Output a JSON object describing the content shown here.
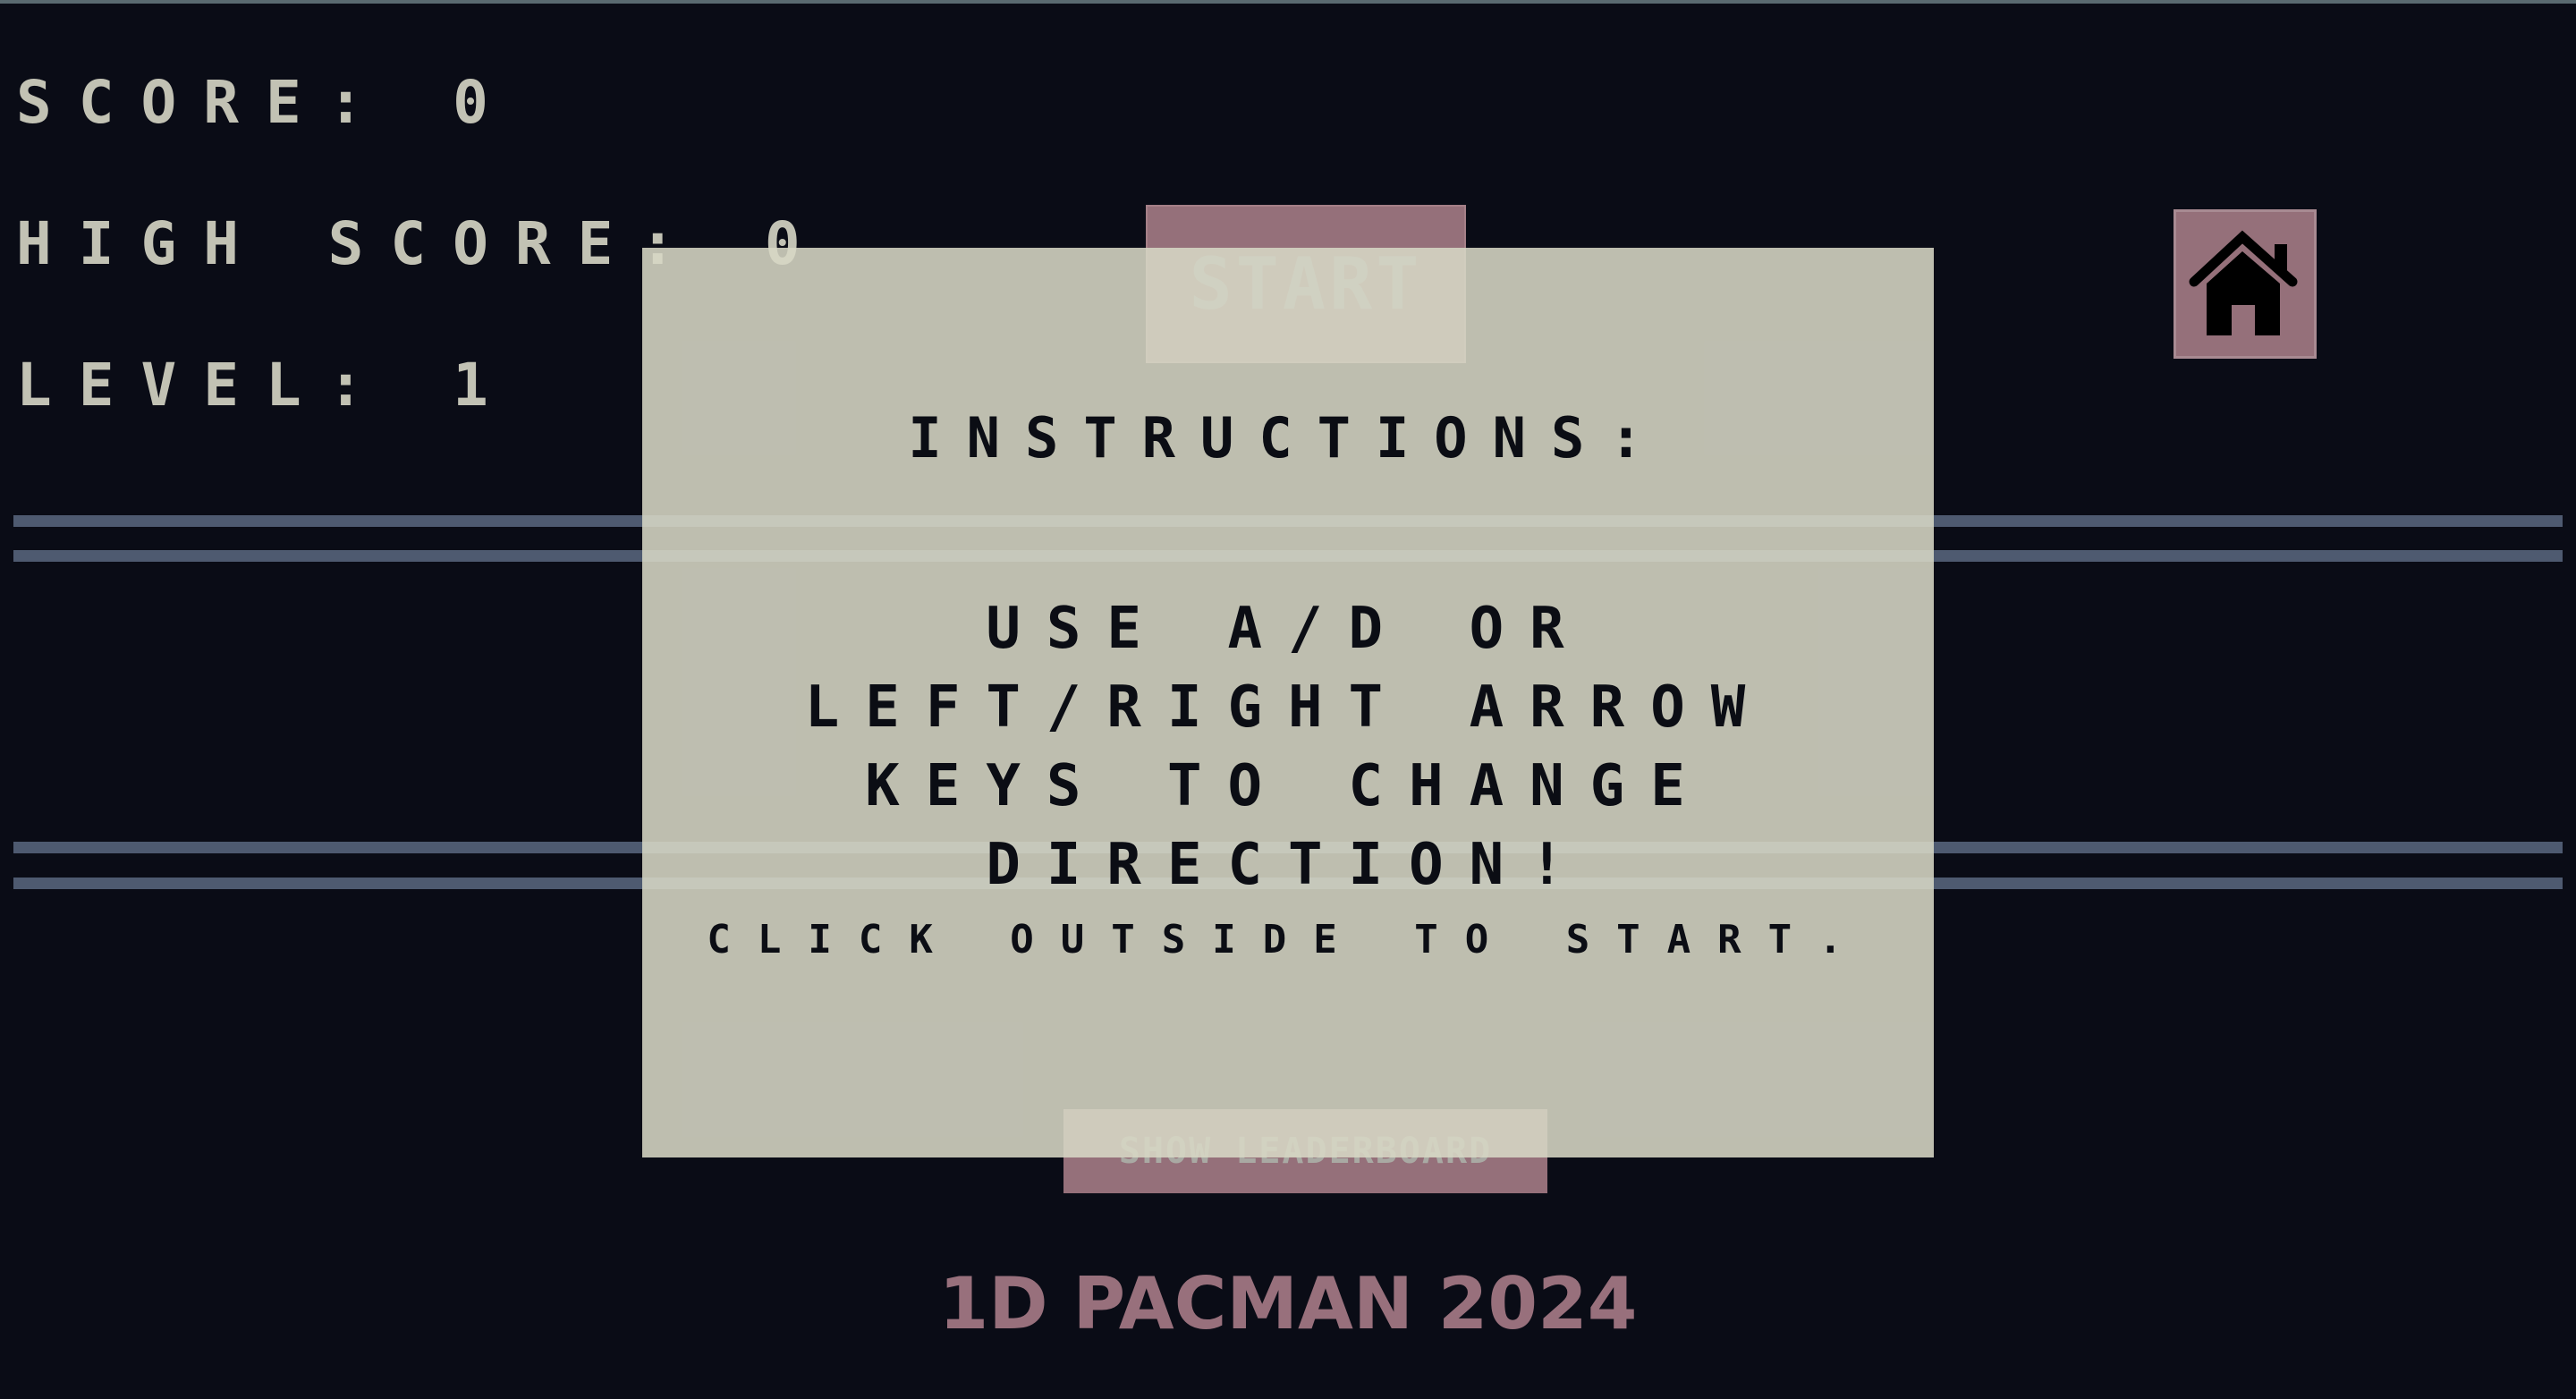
{
  "hud": {
    "score_label": "SCORE: 0",
    "high_score_label": "HIGH SCORE: 0",
    "level_label": "LEVEL: 1"
  },
  "start_button": {
    "label": "START"
  },
  "home_button": {
    "icon": "home-icon"
  },
  "leaderboard_button": {
    "label": "SHOW LEADERBOARD"
  },
  "footer": {
    "title": "1D PACMAN 2024"
  },
  "instructions_modal": {
    "heading": "INSTRUCTIONS:",
    "body": "USE A/D OR LEFT/RIGHT ARROW KEYS TO CHANGE DIRECTION!",
    "note": "CLICK OUTSIDE TO START."
  },
  "colors": {
    "background": "#0a0c16",
    "hud_text": "#c2c2b4",
    "track": "#4e5a70",
    "button": "#95707a",
    "footer_text": "#98707c",
    "modal_bg": "#d7d7c5"
  }
}
